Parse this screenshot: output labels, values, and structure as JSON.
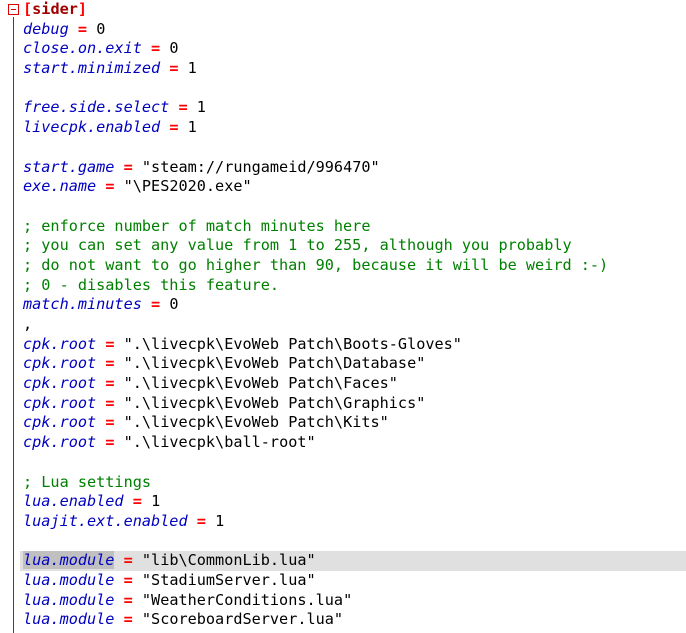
{
  "editor": {
    "section_header": "sider",
    "lines": [
      {
        "type": "kv",
        "key": "debug",
        "value": "0"
      },
      {
        "type": "kv",
        "key": "close.on.exit",
        "value": "0"
      },
      {
        "type": "kv",
        "key": "start.minimized",
        "value": "1"
      },
      {
        "type": "blank"
      },
      {
        "type": "kv",
        "key": "free.side.select",
        "value": "1"
      },
      {
        "type": "kv",
        "key": "livecpk.enabled",
        "value": "1"
      },
      {
        "type": "blank"
      },
      {
        "type": "kv",
        "key": "start.game",
        "value": "\"steam://rungameid/996470\""
      },
      {
        "type": "kv",
        "key": "exe.name",
        "value": "\"\\PES2020.exe\""
      },
      {
        "type": "blank"
      },
      {
        "type": "comment",
        "text": "; enforce number of match minutes here"
      },
      {
        "type": "comment",
        "text": "; you can set any value from 1 to 255, although you probably"
      },
      {
        "type": "comment",
        "text": "; do not want to go higher than 90, because it will be weird :-)"
      },
      {
        "type": "comment",
        "text": "; 0 - disables this feature."
      },
      {
        "type": "kv",
        "key": "match.minutes",
        "value": "0"
      },
      {
        "type": "plain",
        "text": ","
      },
      {
        "type": "kv",
        "key": "cpk.root",
        "value": "\".\\livecpk\\EvoWeb Patch\\Boots-Gloves\""
      },
      {
        "type": "kv",
        "key": "cpk.root",
        "value": "\".\\livecpk\\EvoWeb Patch\\Database\""
      },
      {
        "type": "kv",
        "key": "cpk.root",
        "value": "\".\\livecpk\\EvoWeb Patch\\Faces\""
      },
      {
        "type": "kv",
        "key": "cpk.root",
        "value": "\".\\livecpk\\EvoWeb Patch\\Graphics\""
      },
      {
        "type": "kv",
        "key": "cpk.root",
        "value": "\".\\livecpk\\EvoWeb Patch\\Kits\""
      },
      {
        "type": "kv",
        "key": "cpk.root",
        "value": "\".\\livecpk\\ball-root\""
      },
      {
        "type": "blank"
      },
      {
        "type": "comment",
        "text": "; Lua settings"
      },
      {
        "type": "kv",
        "key": "lua.enabled",
        "value": "1"
      },
      {
        "type": "kv",
        "key": "luajit.ext.enabled",
        "value": "1"
      },
      {
        "type": "blank"
      },
      {
        "type": "kv",
        "key": "lua.module",
        "value": "\"lib\\CommonLib.lua\"",
        "highlight": true
      },
      {
        "type": "kv",
        "key": "lua.module",
        "value": "\"StadiumServer.lua\""
      },
      {
        "type": "kv",
        "key": "lua.module",
        "value": "\"WeatherConditions.lua\""
      },
      {
        "type": "kv",
        "key": "lua.module",
        "value": "\"ScoreboardServer.lua\""
      }
    ],
    "operator": "="
  }
}
